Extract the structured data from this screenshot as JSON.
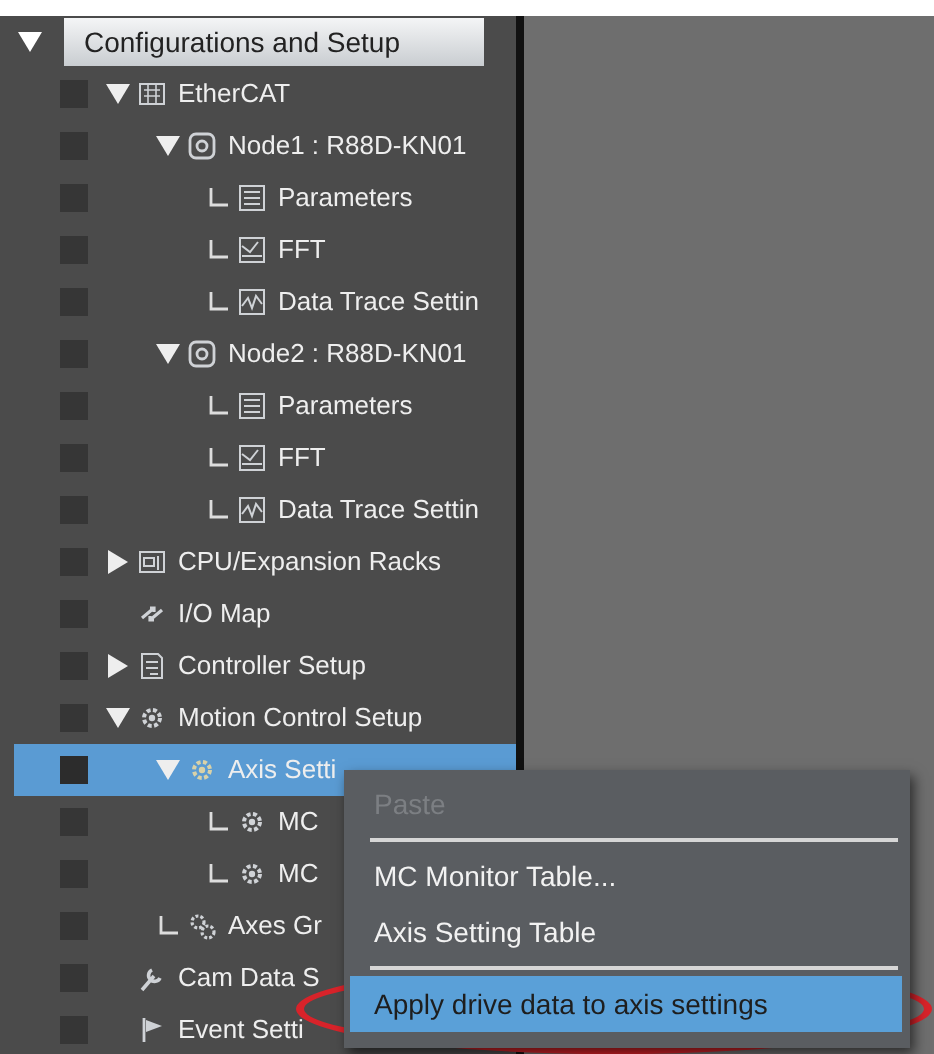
{
  "tree": {
    "label": "Configurations and Setup",
    "kind": "folder",
    "expanded": true,
    "selected": false,
    "children": [
      {
        "label": "EtherCAT",
        "kind": "folder",
        "expanded": true,
        "selected": false,
        "children": [
          {
            "label": "Node1 : R88D-KN01",
            "kind": "folder",
            "expanded": true,
            "selected": false,
            "children": [
              {
                "label": "Parameters",
                "kind": "leaf",
                "selected": false
              },
              {
                "label": "FFT",
                "kind": "leaf",
                "selected": false
              },
              {
                "label": "Data Trace Settin",
                "kind": "leaf",
                "selected": false
              }
            ]
          },
          {
            "label": "Node2 : R88D-KN01",
            "kind": "folder",
            "expanded": true,
            "selected": false,
            "children": [
              {
                "label": "Parameters",
                "kind": "leaf",
                "selected": false
              },
              {
                "label": "FFT",
                "kind": "leaf",
                "selected": false
              },
              {
                "label": "Data Trace Settin",
                "kind": "leaf",
                "selected": false
              }
            ]
          }
        ]
      },
      {
        "label": "CPU/Expansion Racks",
        "kind": "folder",
        "expanded": false,
        "selected": false
      },
      {
        "label": "I/O Map",
        "kind": "plain",
        "selected": false
      },
      {
        "label": "Controller Setup",
        "kind": "folder",
        "expanded": false,
        "selected": false
      },
      {
        "label": "Motion Control Setup",
        "kind": "folder",
        "expanded": true,
        "selected": false,
        "children": [
          {
            "label": "Axis Setti",
            "kind": "folder",
            "expanded": true,
            "selected": true,
            "children": [
              {
                "label": "MC",
                "kind": "leaf",
                "selected": false
              },
              {
                "label": "MC",
                "kind": "leaf",
                "selected": false
              }
            ]
          },
          {
            "label": "Axes Gr",
            "kind": "leaf",
            "selected": false
          }
        ]
      },
      {
        "label": "Cam Data S",
        "kind": "plain",
        "selected": false
      },
      {
        "label": "Event Setti",
        "kind": "plain",
        "selected": false
      }
    ]
  },
  "context_menu": {
    "items": [
      {
        "kind": "item",
        "label": "Paste",
        "disabled": true,
        "selected": false
      },
      {
        "kind": "separator"
      },
      {
        "kind": "item",
        "label": "MC Monitor Table...",
        "disabled": false,
        "selected": false
      },
      {
        "kind": "item",
        "label": "Axis Setting Table",
        "disabled": false,
        "selected": false
      },
      {
        "kind": "separator"
      },
      {
        "kind": "item",
        "label": "Apply drive data to axis settings",
        "disabled": false,
        "selected": true
      }
    ]
  }
}
